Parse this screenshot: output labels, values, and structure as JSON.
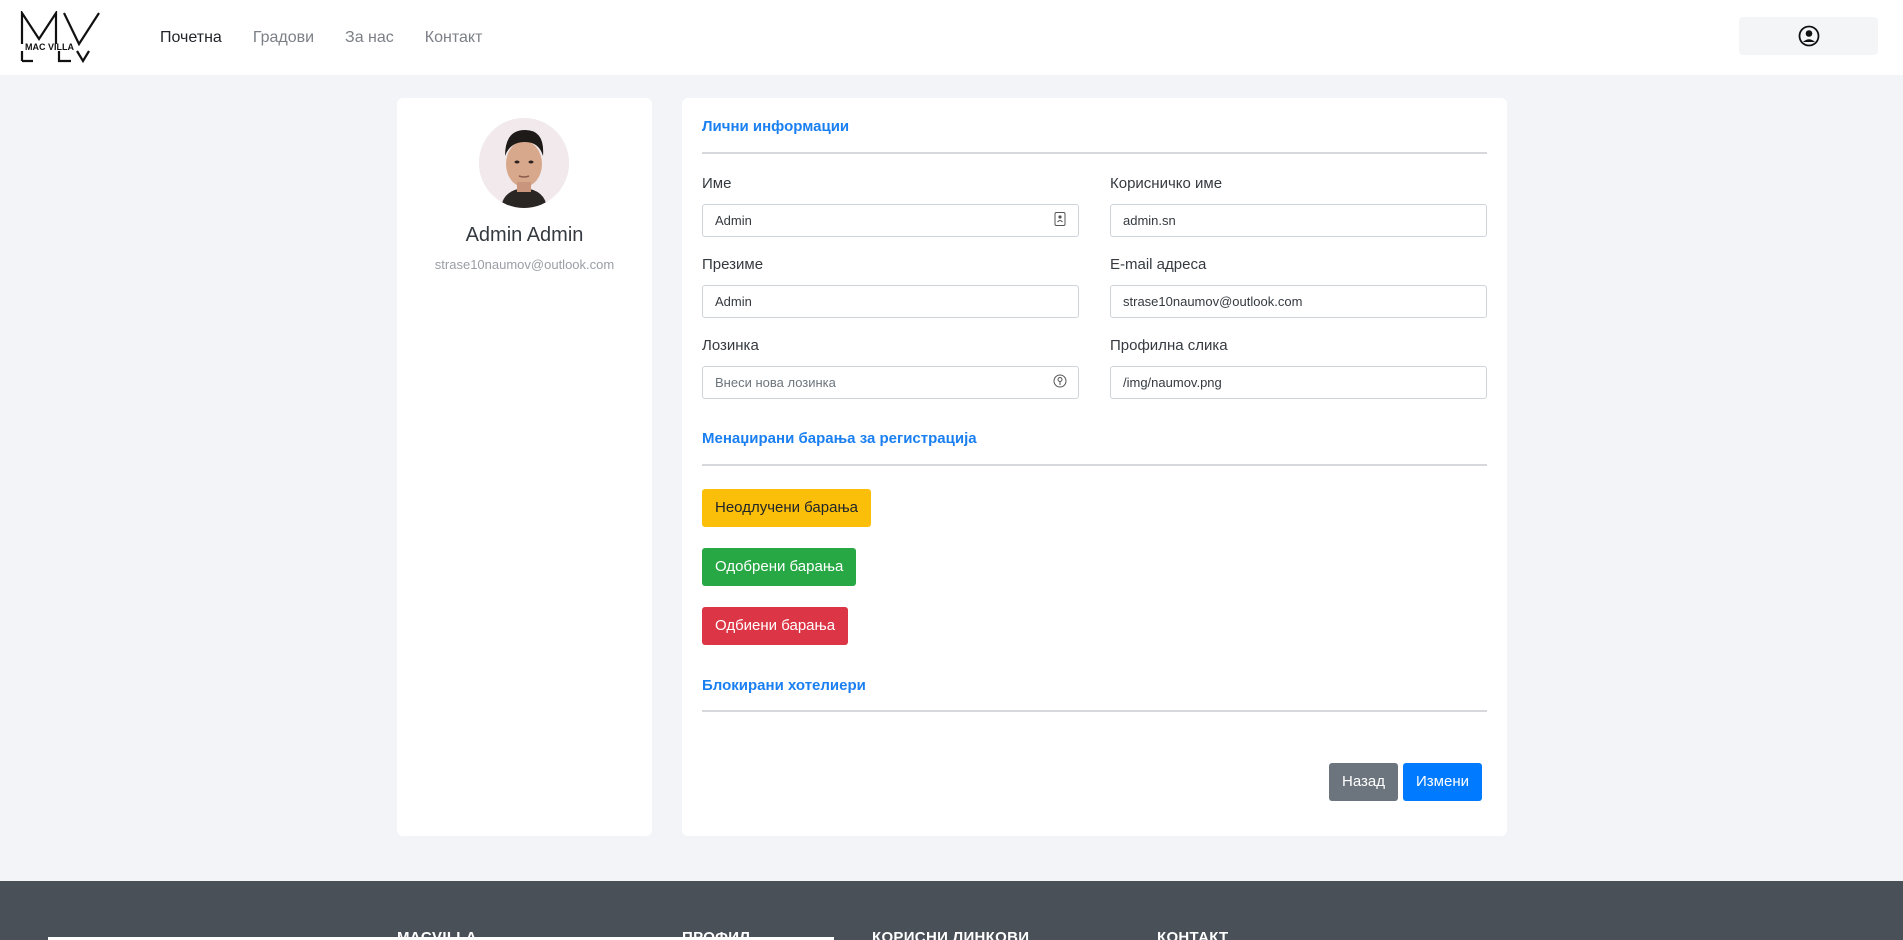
{
  "nav": {
    "logo_text": "MAC VILLA",
    "links": [
      "Почетна",
      "Градови",
      "За нас",
      "Контакт"
    ]
  },
  "profile": {
    "name": "Admin Admin",
    "email": "strase10naumov@outlook.com"
  },
  "personal_info": {
    "title": "Лични информации",
    "first_name": {
      "label": "Име",
      "value": "Admin"
    },
    "username": {
      "label": "Корисничко име",
      "value": "admin.sn"
    },
    "last_name": {
      "label": "Презиме",
      "value": "Admin"
    },
    "email": {
      "label": "E-mail адреса",
      "value": "strase10naumov@outlook.com"
    },
    "password": {
      "label": "Лозинка",
      "placeholder": "Внеси нова лозинка"
    },
    "photo": {
      "label": "Профилна слика",
      "value": "/img/naumov.png"
    }
  },
  "requests": {
    "title": "Менаџирани барања за регистрација",
    "pending": "Неодлучени барања",
    "approved": "Одобрени барања",
    "rejected": "Одбиени барања"
  },
  "blocked": {
    "title": "Блокирани хотелиери"
  },
  "actions": {
    "back": "Назад",
    "edit": "Измени"
  },
  "footer": {
    "headings": [
      "MACVILLA",
      "ПРОФИЛ",
      "КОРИСНИ ЛИНКОВИ",
      "КОНТАКТ"
    ]
  },
  "colors": {
    "accent": "#1a7ff0",
    "warning": "#fbbf0a",
    "success": "#28a745",
    "danger": "#dc3545",
    "secondary": "#6c757d",
    "primary": "#007bff"
  }
}
